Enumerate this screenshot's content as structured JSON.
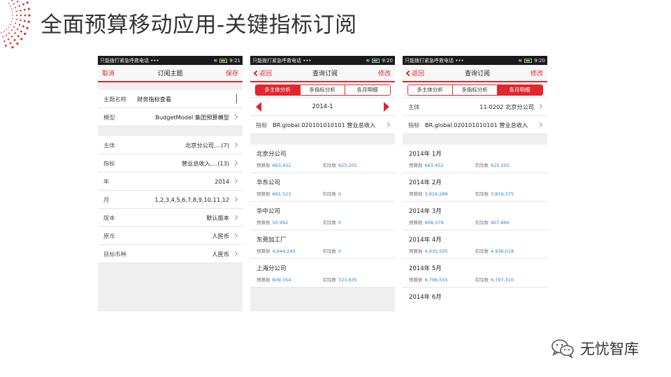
{
  "slide": {
    "title": "全面预算移动应用-关键指标订阅",
    "logo_text": "无忧智库",
    "accent": "#e0262e"
  },
  "screens": [
    {
      "status": {
        "text": "只能拨打紧急呼救电话 •••",
        "time": "9:21"
      },
      "nav": {
        "left": "取消",
        "title": "订阅主题",
        "right": "保存"
      },
      "groups": [
        [
          {
            "label": "主题名称",
            "value": "财务指标查看",
            "chevron": false,
            "cursor": true
          },
          {
            "label": "模型",
            "value": "BudgetModel  集团预算模型",
            "chevron": true
          }
        ],
        [
          {
            "label": "主体",
            "value": "北京分公司,...(7)",
            "chevron": true
          },
          {
            "label": "指标",
            "value": "营业总收入,...(13)",
            "chevron": true
          },
          {
            "label": "年",
            "value": "2014",
            "chevron": true
          },
          {
            "label": "月",
            "value": "1,2,3,4,5,6,7,8,9,10,11,12",
            "chevron": true
          },
          {
            "label": "版本",
            "value": "默认版本",
            "chevron": true
          },
          {
            "label": "原币",
            "value": "人民币",
            "chevron": true
          },
          {
            "label": "目标币种",
            "value": "人民币",
            "chevron": true
          }
        ]
      ]
    },
    {
      "status": {
        "text": "只能拨打紧急呼救电话 •••",
        "time": "9:20"
      },
      "nav": {
        "left": "返回",
        "title": "查询订阅",
        "right": "修改"
      },
      "segments": [
        "多主体分析",
        "多指标分析",
        "各月明细"
      ],
      "active_segment": 0,
      "period": "2014-1",
      "indicator": {
        "label": "指标",
        "value": "BR.global.020101010101 营业总收入"
      },
      "items": [
        {
          "name": "北京分公司",
          "budget_label": "预算数",
          "budget": "663,452",
          "actual_label": "实际数",
          "actual": "625,205"
        },
        {
          "name": "华东公司",
          "budget_label": "预算数",
          "budget": "691,523",
          "actual_label": "实际数",
          "actual": "0"
        },
        {
          "name": "华中公司",
          "budget_label": "预算数",
          "budget": "50,992",
          "actual_label": "实际数",
          "actual": "0"
        },
        {
          "name": "东莞加工厂",
          "budget_label": "预算数",
          "budget": "4,644,245",
          "actual_label": "实际数",
          "actual": "0"
        },
        {
          "name": "上海分公司",
          "budget_label": "预算数",
          "budget": "609,354",
          "actual_label": "实际数",
          "actual": "723,635"
        }
      ]
    },
    {
      "status": {
        "text": "只能拨打紧急呼救电话 •••",
        "time": "9:20"
      },
      "nav": {
        "left": "返回",
        "title": "查询订阅",
        "right": "修改"
      },
      "segments": [
        "多主体分析",
        "多指标分析",
        "各月明细"
      ],
      "active_segment": 2,
      "entity": {
        "label": "主体",
        "value": "11-0202 北京分公司"
      },
      "indicator": {
        "label": "指标",
        "value": "BR.global.020101010101 营业总收入"
      },
      "items": [
        {
          "name": "2014年 1月",
          "budget_label": "预算数",
          "budget": "663,452",
          "actual_label": "实际数",
          "actual": "625,205"
        },
        {
          "name": "2014年 2月",
          "budget_label": "预算数",
          "budget": "3,816,288",
          "actual_label": "实际数",
          "actual": "3,814,375"
        },
        {
          "name": "2014年 3月",
          "budget_label": "预算数",
          "budget": "908,379",
          "actual_label": "实际数",
          "actual": "907,866"
        },
        {
          "name": "2014年 4月",
          "budget_label": "预算数",
          "budget": "4,935,505",
          "actual_label": "实际数",
          "actual": "4,936,018"
        },
        {
          "name": "2014年 5月",
          "budget_label": "预算数",
          "budget": "6,796,555",
          "actual_label": "实际数",
          "actual": "6,797,310"
        },
        {
          "name": "2014年 6月",
          "budget_label": "",
          "budget": "",
          "actual_label": "",
          "actual": ""
        }
      ]
    }
  ]
}
